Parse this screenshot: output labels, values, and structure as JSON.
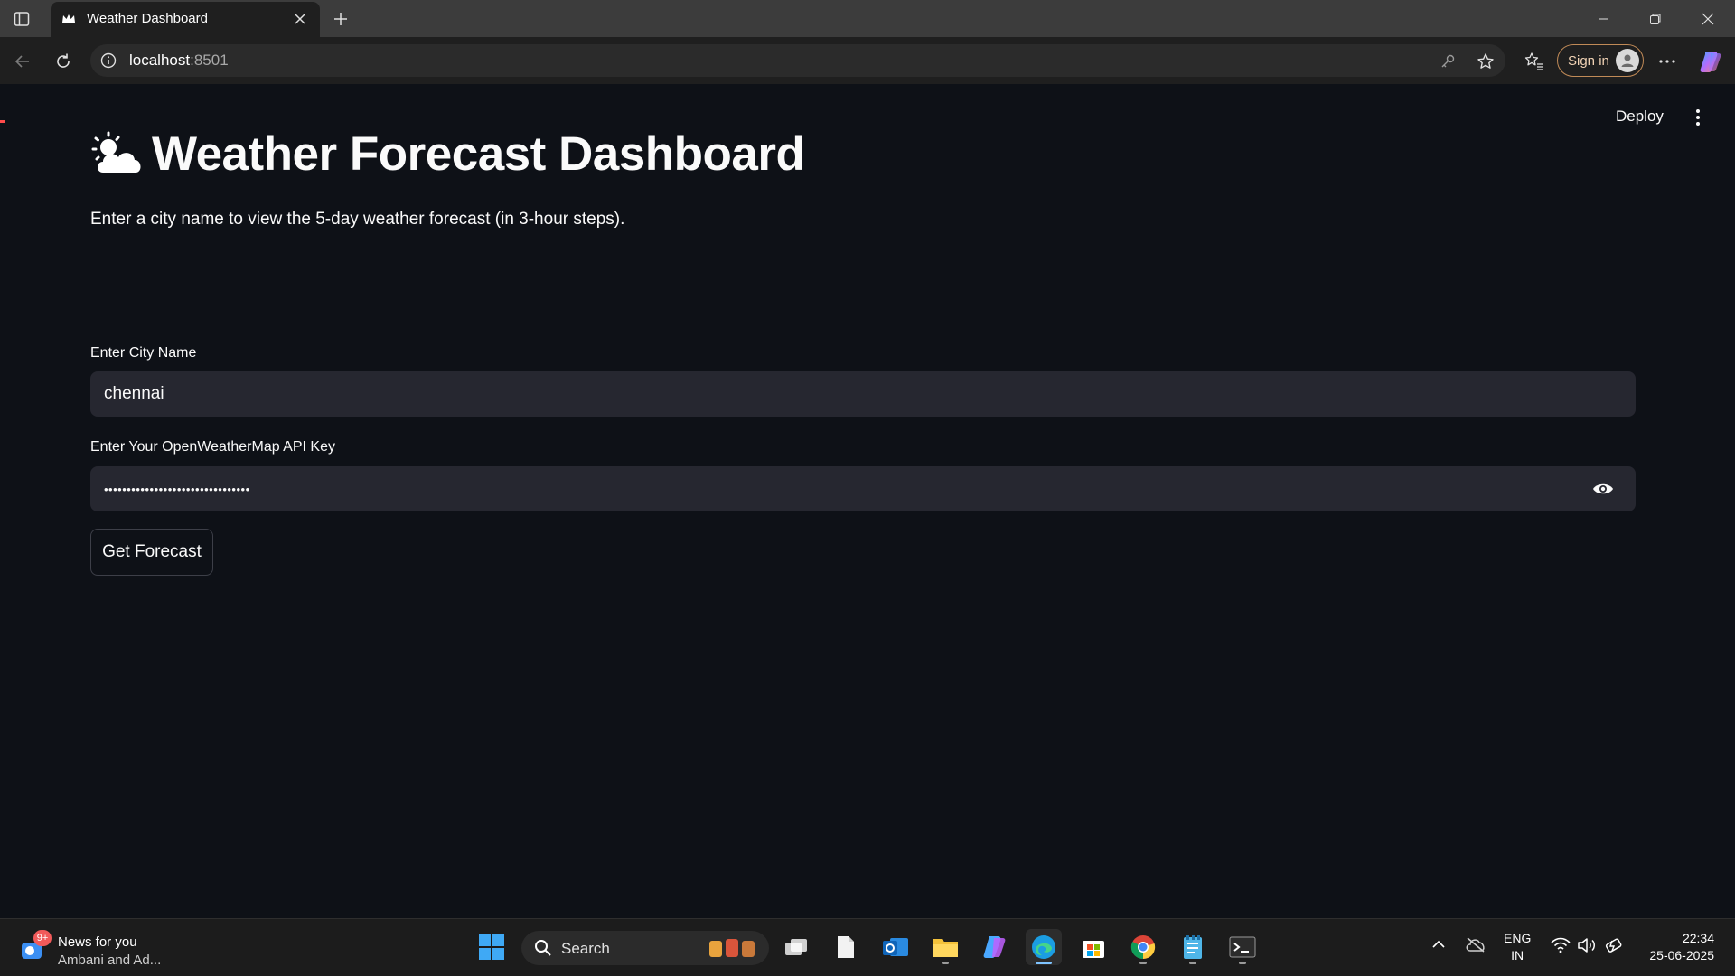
{
  "browser": {
    "tab_title": "Weather Dashboard",
    "url_host": "localhost",
    "url_port": ":8501",
    "signin_label": "Sign in"
  },
  "app": {
    "deploy_label": "Deploy",
    "title": "Weather Forecast Dashboard",
    "title_icon": "sun-behind-cloud-emoji",
    "subtitle": "Enter a city name to view the 5-day weather forecast (in 3-hour steps).",
    "city_label": "Enter City Name",
    "city_value": "chennai",
    "api_label": "Enter Your OpenWeatherMap API Key",
    "api_value": "••••••••••••••••••••••••••••••••",
    "button_label": "Get Forecast"
  },
  "taskbar": {
    "news_badge": "9+",
    "news_title": "News for you",
    "news_subtitle": "Ambani and Ad...",
    "search_label": "Search",
    "lang_top": "ENG",
    "lang_bottom": "IN",
    "time": "22:34",
    "date": "25-06-2025"
  },
  "colors": {
    "page_bg": "#0e1117",
    "input_bg": "#262730",
    "text": "#fafafa",
    "accent_gradient": [
      "#ff4b4b",
      "#ffd34e"
    ]
  }
}
